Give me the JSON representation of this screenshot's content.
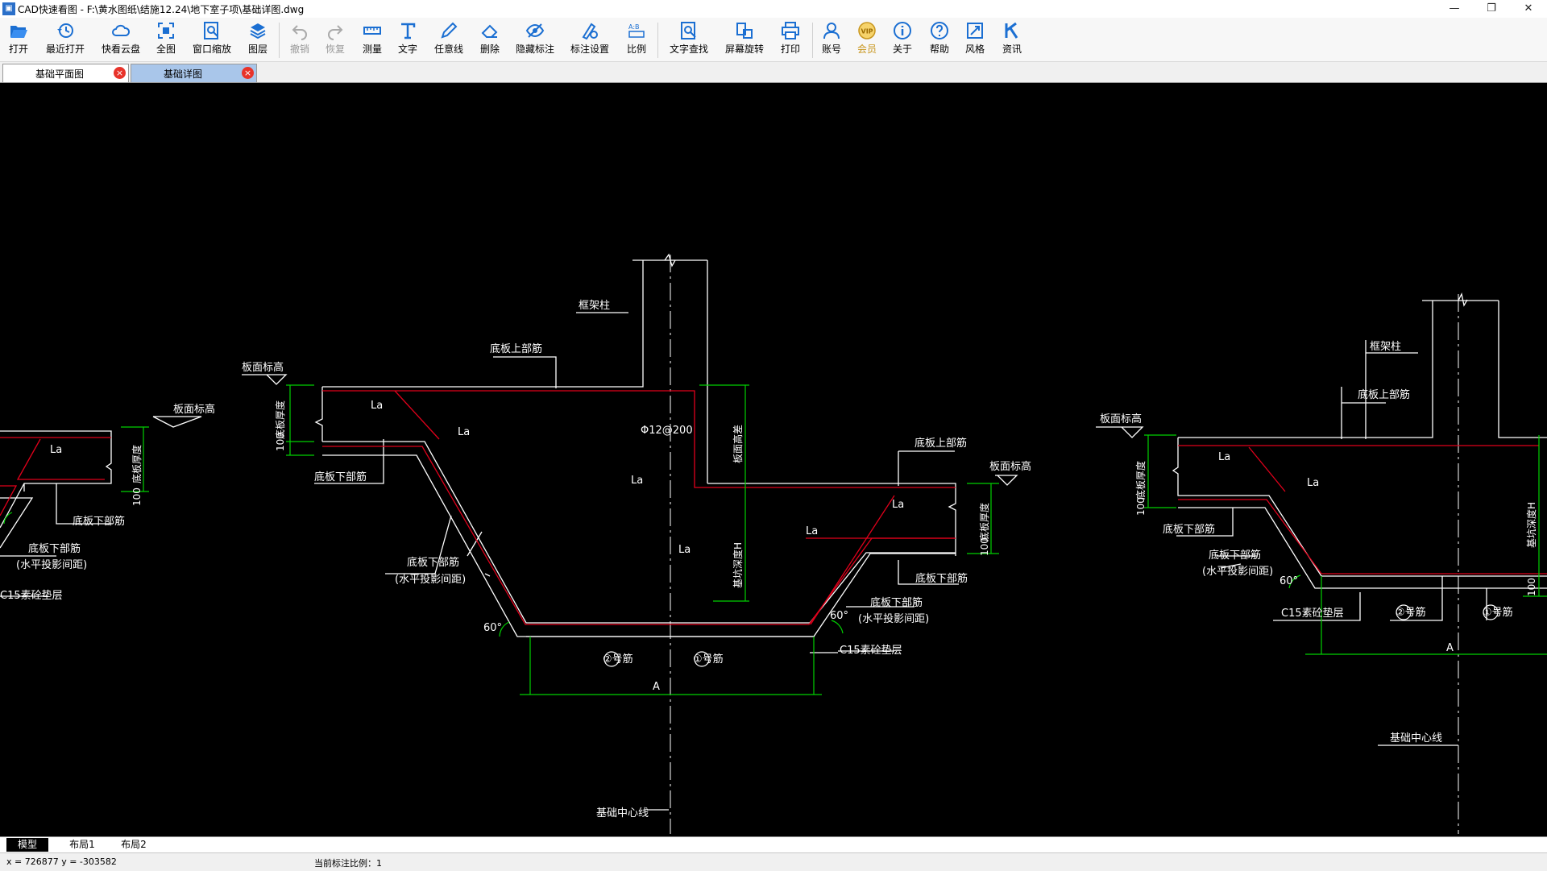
{
  "app": {
    "title": "CAD快速看图 - F:\\黄水图纸\\结施12.24\\地下室子项\\基础详图.dwg",
    "icon_name": "cad-app-icon"
  },
  "window_controls": {
    "minimize": "—",
    "restore": "❐",
    "close": "✕"
  },
  "toolbar": [
    {
      "id": "open",
      "label": "打开",
      "icon": "folder-open-icon",
      "enabled": true
    },
    {
      "id": "recent",
      "label": "最近打开",
      "icon": "history-icon",
      "enabled": true
    },
    {
      "id": "cloud",
      "label": "快看云盘",
      "icon": "cloud-icon",
      "enabled": true
    },
    {
      "id": "fullview",
      "label": "全图",
      "icon": "fit-view-icon",
      "enabled": true
    },
    {
      "id": "windowzoom",
      "label": "窗口缩放",
      "icon": "window-zoom-icon",
      "enabled": true
    },
    {
      "id": "layers",
      "label": "图层",
      "icon": "layers-icon",
      "enabled": true
    },
    {
      "id": "undo",
      "label": "撤销",
      "icon": "undo-icon",
      "enabled": false
    },
    {
      "id": "redo",
      "label": "恢复",
      "icon": "redo-icon",
      "enabled": false
    },
    {
      "id": "measure",
      "label": "测量",
      "icon": "ruler-icon",
      "enabled": true
    },
    {
      "id": "text",
      "label": "文字",
      "icon": "text-icon",
      "enabled": true
    },
    {
      "id": "freeline",
      "label": "任意线",
      "icon": "pen-icon",
      "enabled": true
    },
    {
      "id": "delete",
      "label": "删除",
      "icon": "eraser-icon",
      "enabled": true
    },
    {
      "id": "hidemarks",
      "label": "隐藏标注",
      "icon": "eye-hide-icon",
      "enabled": true
    },
    {
      "id": "marksettings",
      "label": "标注设置",
      "icon": "annotation-settings-icon",
      "enabled": true
    },
    {
      "id": "scale",
      "label": "比例",
      "icon": "scale-icon",
      "enabled": true
    },
    {
      "id": "findtext",
      "label": "文字查找",
      "icon": "find-text-icon",
      "enabled": true
    },
    {
      "id": "rotate",
      "label": "屏幕旋转",
      "icon": "rotate-screen-icon",
      "enabled": true
    },
    {
      "id": "print",
      "label": "打印",
      "icon": "printer-icon",
      "enabled": true
    },
    {
      "id": "account",
      "label": "账号",
      "icon": "user-icon",
      "enabled": true
    },
    {
      "id": "vip",
      "label": "会员",
      "icon": "vip-icon",
      "enabled": true
    },
    {
      "id": "about",
      "label": "关于",
      "icon": "info-icon",
      "enabled": true
    },
    {
      "id": "help",
      "label": "帮助",
      "icon": "help-icon",
      "enabled": true
    },
    {
      "id": "style",
      "label": "风格",
      "icon": "style-icon",
      "enabled": true
    },
    {
      "id": "news",
      "label": "资讯",
      "icon": "news-icon",
      "enabled": true
    }
  ],
  "tabs": [
    {
      "label": "基础平面图",
      "active": false
    },
    {
      "label": "基础详图",
      "active": true
    }
  ],
  "drawing": {
    "labels": {
      "frame_column": "框架柱",
      "top_rebar": "底板上部筋",
      "bottom_rebar": "底板下部筋",
      "bottom_rebar_proj_1": "底板下部筋",
      "bottom_rebar_proj_2": "(水平投影间距)",
      "slab_elev": "板面标高",
      "slab_thickness": "底板厚度",
      "pit_depth": "基坑深度H",
      "slab_elev_diff": "板面高差",
      "c15_layer": "C15素砼垫层",
      "c15_layer_cut": "C15素砼垫层",
      "c15_layer_left": "C15素砼垫层",
      "bar2": "②号筋",
      "bar1": "①号筋",
      "dim_a": "A",
      "la": "La",
      "rebar_spec": "Φ12@200",
      "dim_100": "100",
      "angle_60": "60°",
      "center_line": "基础中心线"
    },
    "colors": {
      "background": "#000000",
      "lines": "#ffffff",
      "rebar": "#e0001b",
      "dimension": "#00d000"
    }
  },
  "layout_tabs": [
    {
      "label": "模型",
      "active": true
    },
    {
      "label": "布局1",
      "active": false
    },
    {
      "label": "布局2",
      "active": false
    }
  ],
  "status": {
    "coords": "x = 726877  y = -303582",
    "scale_text": "当前标注比例：1"
  }
}
